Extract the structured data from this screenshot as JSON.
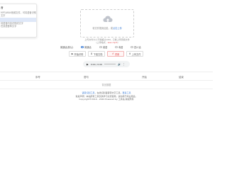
{
  "left_panel": {
    "title": "音",
    "lines": [
      "MP3/WAV音频文件，可将语音识别成",
      "文字"
    ],
    "active_item": "",
    "items": [
      "将语音内容识别成文字",
      "在线语音转文字"
    ]
  },
  "upload": {
    "icon": "cloud-upload-icon",
    "text": "将文件拖到此处，或",
    "link": "点击上传",
    "hint_line1": "上传文件大小不能超过10M，只能上传音频文件",
    "hint_line2_prefix": "(上传格式：",
    "hint_line2_red": "wav,mp3",
    "hint_line2_suffix": ")"
  },
  "options": [
    {
      "label": "普通话(默认)",
      "checked": false
    },
    {
      "label": "普通话",
      "checked": true
    },
    {
      "label": "英语",
      "checked": false
    },
    {
      "label": "粤语",
      "checked": false
    },
    {
      "label": "四川话",
      "checked": false
    }
  ],
  "buttons": [
    {
      "label": "开始识别",
      "icon": "play-icon",
      "style": "normal"
    },
    {
      "label": "下载文档",
      "icon": "download-icon",
      "style": "normal"
    },
    {
      "label": "重置",
      "icon": "reset-icon",
      "style": "red"
    },
    {
      "label": "上传文件",
      "icon": "upload-icon",
      "style": "normal"
    }
  ],
  "player": {
    "time": "0:00 / 0:00",
    "play_icon": "play-icon",
    "volume_icon": "volume-icon",
    "more_icon": "more-icon"
  },
  "table": {
    "columns": [
      "序号",
      "语句",
      "开始",
      "结束"
    ],
    "empty_text": "暂无数据"
  },
  "footer": {
    "line1_link": "语音识别工具",
    "line1_text": "，在线识别语音转文字工具，",
    "line1_link2": "更多工具",
    "line2": "免责声明：本站所有工具仅供学习交流使用，请勿用于商业用途。",
    "line3": "Copyright©2019 - 2024 Powered by 工具站 版权所有"
  }
}
